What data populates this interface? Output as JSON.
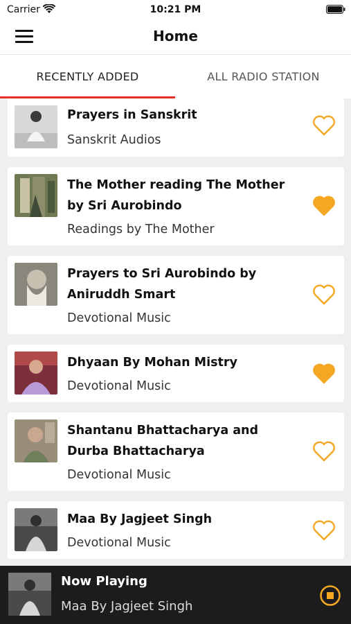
{
  "status_bar": {
    "carrier": "Carrier",
    "time": "10:21 PM",
    "wifi_icon": "wifi-icon",
    "battery_icon": "battery-icon"
  },
  "nav": {
    "title": "Home",
    "menu_icon": "menu-icon"
  },
  "tabs": [
    {
      "label": "RECENTLY ADDED",
      "selected": true
    },
    {
      "label": "ALL RADIO STATION",
      "selected": false
    }
  ],
  "colors": {
    "accent": "#f5a623",
    "tab_indicator": "#e53025",
    "player_bg": "#1c1c1c"
  },
  "items": [
    {
      "title": "Prayers in Sanskrit",
      "subtitle": "Sanskrit Audios",
      "favorite": false
    },
    {
      "title": "The Mother reading The Mother by Sri Aurobindo",
      "subtitle": "Readings by The Mother",
      "favorite": true
    },
    {
      "title": "Prayers to Sri Aurobindo by Aniruddh Smart",
      "subtitle": "Devotional Music",
      "favorite": false
    },
    {
      "title": "Dhyaan By Mohan Mistry",
      "subtitle": "Devotional Music",
      "favorite": true
    },
    {
      "title": "Shantanu Bhattacharya and Durba Bhattacharya",
      "subtitle": "Devotional Music",
      "favorite": false
    },
    {
      "title": "Maa By Jagjeet Singh",
      "subtitle": "Devotional Music",
      "favorite": false
    }
  ],
  "now_playing": {
    "label": "Now Playing",
    "track": "Maa By Jagjeet Singh",
    "control_icon": "stop-icon"
  }
}
